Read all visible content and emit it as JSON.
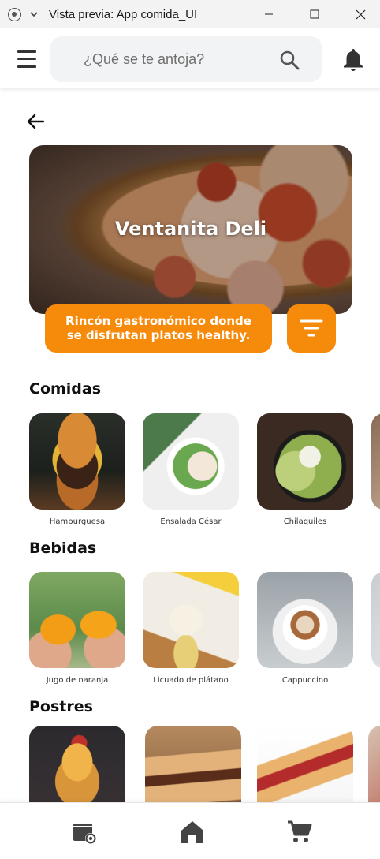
{
  "window": {
    "title": "Vista previa: App comida_UI"
  },
  "header": {
    "search_placeholder": "¿Qué se te antoja?",
    "icons": [
      "menu-icon",
      "search-icon",
      "bell-icon"
    ]
  },
  "restaurant": {
    "name": "Ventanita Deli",
    "description_line1": "Rincón gastronómico donde",
    "description_line2": "se disfrutan platos healthy."
  },
  "sections": [
    {
      "title": "Comidas",
      "items": [
        {
          "label": "Hamburguesa"
        },
        {
          "label": "Ensalada César"
        },
        {
          "label": "Chilaquiles"
        }
      ]
    },
    {
      "title": "Bebidas",
      "items": [
        {
          "label": "Jugo de naranja"
        },
        {
          "label": "Licuado de plátano"
        },
        {
          "label": "Cappuccino"
        }
      ]
    },
    {
      "title": "Postres",
      "items": [
        {
          "label": ""
        },
        {
          "label": ""
        },
        {
          "label": ""
        }
      ]
    }
  ],
  "bottom_nav": {
    "icons": [
      "orders-icon",
      "home-icon",
      "cart-icon"
    ]
  },
  "colors": {
    "accent": "#f58a0b",
    "icon_dark": "#333333",
    "search_bg": "#f2f3f5"
  }
}
